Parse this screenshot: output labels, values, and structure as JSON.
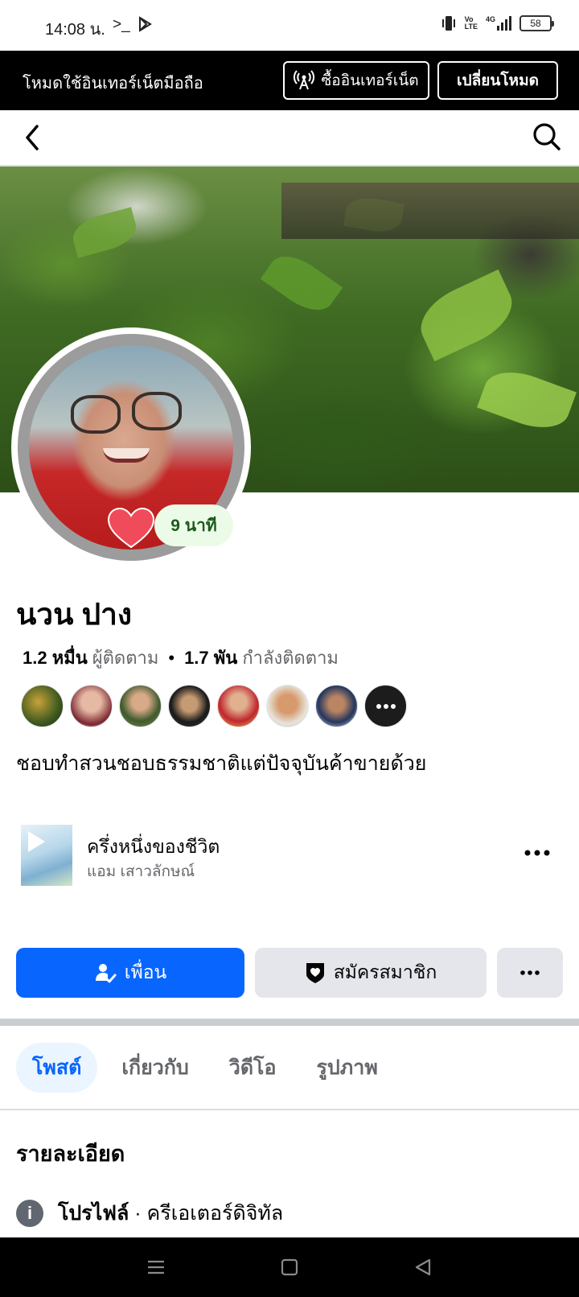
{
  "status_bar": {
    "time": "14:08 น.",
    "battery": "58",
    "network": "4G",
    "volte": "Vo LTE"
  },
  "data_banner": {
    "text": "โหมดใช้อินเทอร์เน็ตมือถือ",
    "buy_button": "ซื้ออินเทอร์เน็ต",
    "switch_button": "เปลี่ยนโหมด"
  },
  "profile": {
    "name": "นวน ปาง",
    "story_time": "9 นาที",
    "followers_count": "1.2 หมื่น",
    "followers_label": "ผู้ติดตาม",
    "following_count": "1.7 พัน",
    "following_label": "กำลังติดตาม",
    "bio": "ชอบทำสวนชอบธรรมชาติแต่ปัจจุบันค้าขายด้วย"
  },
  "music": {
    "title": "ครึ่งหนึ่งของชีวิต",
    "artist": "แอม เสาวลักษณ์"
  },
  "actions": {
    "friend": "เพื่อน",
    "subscribe": "สมัครสมาชิก"
  },
  "tabs": [
    {
      "label": "โพสต์",
      "active": true
    },
    {
      "label": "เกี่ยวกับ",
      "active": false
    },
    {
      "label": "วิดีโอ",
      "active": false
    },
    {
      "label": "รูปภาพ",
      "active": false
    }
  ],
  "details": {
    "title": "รายละเอียด",
    "profile_label": "โปรไฟล์",
    "profile_value": "· ครีเอเตอร์ดิจิทัล"
  },
  "colors": {
    "primary": "#0866ff",
    "secondary_button": "#e4e6eb",
    "active_tab_bg": "#ebf5ff",
    "muted_text": "#65676b"
  }
}
